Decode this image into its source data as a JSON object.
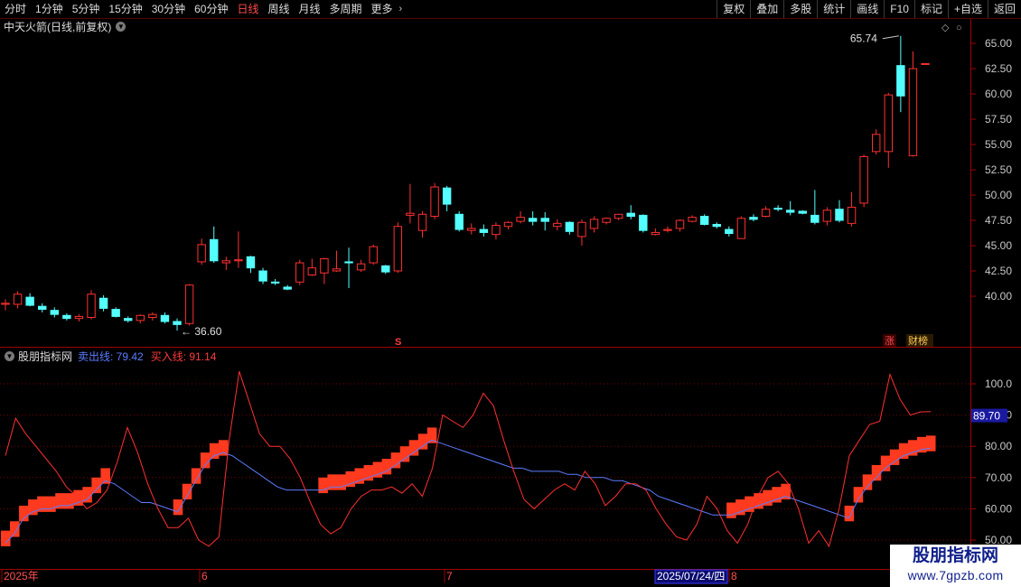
{
  "toolbar": {
    "periods": [
      "分时",
      "1分钟",
      "5分钟",
      "15分钟",
      "30分钟",
      "60分钟",
      "日线",
      "周线",
      "月线",
      "多周期",
      "更多"
    ],
    "active": "日线",
    "more_chevron": "chevron-right-icon",
    "right_buttons": [
      "复权",
      "叠加",
      "多股",
      "统计",
      "画线",
      "F10",
      "标记",
      "+自选",
      "返回"
    ]
  },
  "stock_title": "中天火箭(日线,前复权)",
  "price_chart": {
    "high_label": "65.74",
    "low_label": "36.60",
    "y_ticks": [
      "65.00",
      "62.50",
      "60.00",
      "57.50",
      "55.00",
      "52.50",
      "50.00",
      "47.50",
      "45.00",
      "42.50",
      "40.00"
    ],
    "event_marker": "S",
    "badge_rise": "涨",
    "badge_rank": "财榜",
    "colors": {
      "up": "#ff3030",
      "down": "#54ffff",
      "background": "#000000",
      "grid": "#7a0000"
    }
  },
  "indicator": {
    "name": "股朋指标网",
    "sell_label": "卖出线: 79.42",
    "buy_label": "买入线: 91.14",
    "y_ticks": [
      "100.0",
      "90.00",
      "80.00",
      "70.00",
      "60.00",
      "50.00"
    ],
    "current_value": "89.70",
    "colors": {
      "sell_line": "#5b7cff",
      "buy_line": "#ff3030",
      "bar": "#ff3a1e"
    }
  },
  "x_axis": {
    "labels": [
      "2025年",
      "6",
      "7",
      "8"
    ],
    "cursor_date": "2025/07/24/四"
  },
  "watermark": {
    "title": "股朋指标网",
    "url": "www.7gpzb.com"
  },
  "chart_data": [
    {
      "type": "candlestick",
      "title": "中天火箭(日线,前复权)",
      "ylim": [
        38,
        66
      ],
      "ohlc": [
        [
          39.2,
          39.7,
          38.6,
          39.3
        ],
        [
          39.2,
          40.5,
          38.8,
          40.2
        ],
        [
          39.9,
          40.3,
          39.0,
          39.1
        ],
        [
          39.0,
          39.3,
          38.4,
          38.7
        ],
        [
          38.6,
          38.9,
          37.9,
          38.2
        ],
        [
          38.1,
          38.3,
          37.6,
          37.8
        ],
        [
          37.8,
          38.2,
          37.5,
          38.0
        ],
        [
          37.9,
          40.6,
          37.7,
          40.2
        ],
        [
          39.8,
          40.1,
          38.5,
          38.8
        ],
        [
          38.7,
          38.9,
          37.9,
          38.0
        ],
        [
          37.8,
          38.0,
          37.4,
          37.6
        ],
        [
          37.6,
          38.2,
          37.3,
          38.1
        ],
        [
          37.9,
          38.4,
          37.6,
          38.2
        ],
        [
          38.1,
          38.4,
          37.3,
          37.5
        ],
        [
          37.5,
          37.8,
          36.6,
          37.2
        ],
        [
          37.3,
          41.2,
          37.1,
          41.1
        ],
        [
          43.4,
          45.7,
          43.1,
          45.1
        ],
        [
          45.6,
          46.9,
          43.3,
          43.5
        ],
        [
          43.3,
          43.9,
          42.6,
          43.5
        ],
        [
          43.5,
          46.4,
          42.8,
          43.6
        ],
        [
          43.9,
          44.0,
          42.3,
          42.8
        ],
        [
          42.5,
          42.8,
          41.2,
          41.5
        ],
        [
          41.4,
          41.7,
          41.1,
          41.3
        ],
        [
          40.9,
          41.1,
          40.6,
          40.7
        ],
        [
          41.4,
          43.6,
          41.1,
          43.3
        ],
        [
          42.1,
          43.7,
          42.0,
          42.8
        ],
        [
          42.3,
          43.8,
          41.2,
          43.7
        ],
        [
          42.5,
          44.5,
          42.4,
          42.7
        ],
        [
          43.4,
          44.8,
          40.8,
          43.3
        ],
        [
          42.6,
          43.6,
          42.4,
          43.2
        ],
        [
          43.3,
          45.1,
          43.1,
          44.9
        ],
        [
          43.0,
          43.1,
          42.2,
          42.4
        ],
        [
          42.5,
          47.3,
          42.3,
          46.9
        ],
        [
          48.0,
          51.1,
          47.2,
          48.2
        ],
        [
          46.5,
          48.4,
          45.8,
          48.1
        ],
        [
          47.9,
          51.2,
          47.6,
          50.8
        ],
        [
          50.7,
          50.9,
          48.4,
          49.1
        ],
        [
          48.1,
          48.4,
          46.4,
          46.6
        ],
        [
          46.5,
          47.2,
          46.1,
          46.7
        ],
        [
          46.6,
          47.1,
          45.9,
          46.3
        ],
        [
          46.1,
          47.3,
          45.6,
          47.0
        ],
        [
          46.9,
          47.4,
          46.6,
          47.3
        ],
        [
          47.4,
          48.4,
          47.2,
          47.8
        ],
        [
          47.7,
          48.4,
          47.0,
          47.4
        ],
        [
          47.7,
          48.3,
          46.5,
          47.4
        ],
        [
          46.9,
          47.6,
          46.5,
          47.2
        ],
        [
          47.3,
          47.4,
          46.1,
          46.4
        ],
        [
          45.9,
          47.6,
          45.0,
          47.3
        ],
        [
          46.7,
          47.9,
          46.3,
          47.6
        ],
        [
          47.3,
          47.8,
          47.1,
          47.7
        ],
        [
          47.7,
          48.1,
          47.5,
          48.1
        ],
        [
          48.2,
          49.0,
          47.6,
          47.9
        ],
        [
          48.0,
          48.1,
          46.3,
          46.5
        ],
        [
          46.1,
          46.7,
          46.0,
          46.3
        ],
        [
          46.5,
          46.9,
          46.3,
          46.6
        ],
        [
          46.7,
          47.6,
          46.4,
          47.5
        ],
        [
          47.4,
          48.0,
          47.3,
          47.8
        ],
        [
          47.9,
          48.1,
          47.0,
          47.1
        ],
        [
          47.1,
          47.3,
          46.7,
          46.9
        ],
        [
          46.6,
          46.9,
          45.9,
          46.2
        ],
        [
          45.7,
          47.9,
          45.7,
          47.7
        ],
        [
          47.8,
          48.1,
          47.4,
          47.6
        ],
        [
          47.9,
          48.9,
          47.8,
          48.6
        ],
        [
          48.7,
          49.0,
          48.4,
          48.6
        ],
        [
          48.5,
          49.4,
          48.0,
          48.3
        ],
        [
          48.4,
          48.5,
          48.1,
          48.2
        ],
        [
          48.0,
          50.5,
          47.1,
          47.3
        ],
        [
          47.4,
          48.8,
          47.0,
          48.5
        ],
        [
          48.6,
          49.5,
          47.3,
          47.5
        ],
        [
          47.2,
          50.3,
          46.9,
          48.8
        ],
        [
          49.2,
          54.0,
          48.8,
          53.8
        ],
        [
          54.3,
          56.5,
          54.0,
          56.0
        ],
        [
          54.3,
          60.1,
          52.7,
          59.9
        ],
        [
          62.8,
          65.74,
          58.2,
          59.8
        ],
        [
          53.9,
          64.2,
          53.8,
          62.5
        ],
        [
          63.0,
          63.0,
          63.0,
          63.0
        ]
      ]
    },
    {
      "type": "line",
      "title": "股朋指标网",
      "ylim": [
        49,
        109
      ],
      "series": [
        {
          "name": "卖出线",
          "values": [
            49,
            52,
            57,
            59,
            60,
            60,
            61,
            61,
            62,
            63,
            66,
            69,
            68,
            66,
            64,
            62,
            62,
            61,
            60,
            59,
            64,
            69,
            74,
            77,
            78,
            77,
            75,
            73,
            71,
            69,
            67,
            66,
            66,
            66,
            66,
            66,
            67,
            67,
            68,
            69,
            70,
            71,
            72,
            74,
            76,
            78,
            80,
            82,
            81,
            80,
            79,
            78,
            77,
            76,
            75,
            74,
            73,
            73,
            72,
            72,
            72,
            72,
            71,
            71,
            70,
            70,
            70,
            69,
            69,
            68,
            67,
            66,
            64,
            63,
            62,
            61,
            60,
            59,
            58,
            58,
            58,
            59,
            60,
            61,
            62,
            63,
            64,
            63,
            62,
            61,
            60,
            59,
            58,
            57,
            63,
            67,
            70,
            73,
            75,
            77,
            78,
            79,
            79.42
          ]
        },
        {
          "name": "买入线",
          "values": [
            77,
            89,
            84,
            80,
            76,
            72,
            67,
            64,
            60,
            62,
            66,
            75,
            86,
            78,
            68,
            60,
            54,
            54,
            57,
            50,
            48,
            51,
            82,
            104,
            94,
            84,
            80,
            80,
            76,
            70,
            62,
            55,
            52,
            54,
            60,
            64,
            66,
            66,
            67,
            65,
            68,
            64,
            73,
            90,
            88,
            86,
            90,
            97,
            93,
            82,
            72,
            63,
            60,
            63,
            66,
            68,
            66,
            72,
            68,
            61,
            64,
            68,
            68,
            66,
            60,
            55,
            51,
            50,
            55,
            64,
            60,
            53,
            49,
            55,
            64,
            70,
            72,
            68,
            60,
            49,
            53,
            48,
            60,
            77,
            82,
            87,
            88,
            103,
            95,
            90,
            91,
            91.14
          ]
        }
      ]
    }
  ]
}
